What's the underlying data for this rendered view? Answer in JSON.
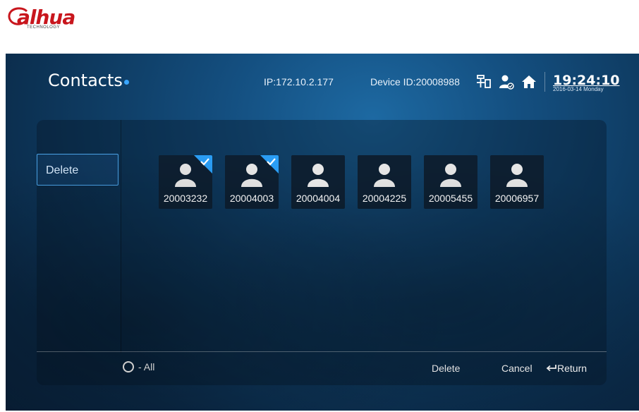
{
  "brand": {
    "name": "alhua",
    "tagline": "TECHNOLOGY"
  },
  "header": {
    "title": "Contacts",
    "ip": "IP:172.10.2.177",
    "device_id": "Device ID:20008988",
    "time": "19:24:10",
    "date": "2016-03-14 Monday",
    "icons": [
      "network-icon",
      "user-status-icon",
      "home-icon"
    ]
  },
  "sidebar": {
    "delete_label": "Delete"
  },
  "contacts": [
    {
      "number": "20003232",
      "selected": true
    },
    {
      "number": "20004003",
      "selected": true
    },
    {
      "number": "20004004",
      "selected": false
    },
    {
      "number": "20004225",
      "selected": false
    },
    {
      "number": "20005455",
      "selected": false
    },
    {
      "number": "20006957",
      "selected": false
    }
  ],
  "footer": {
    "all_label": "- All",
    "delete_label": "Delete",
    "cancel_label": "Cancel",
    "return_label": "Return"
  },
  "colors": {
    "accent": "#3aa6ff",
    "brand_red": "#c8161d",
    "background": "#0e3a60"
  }
}
